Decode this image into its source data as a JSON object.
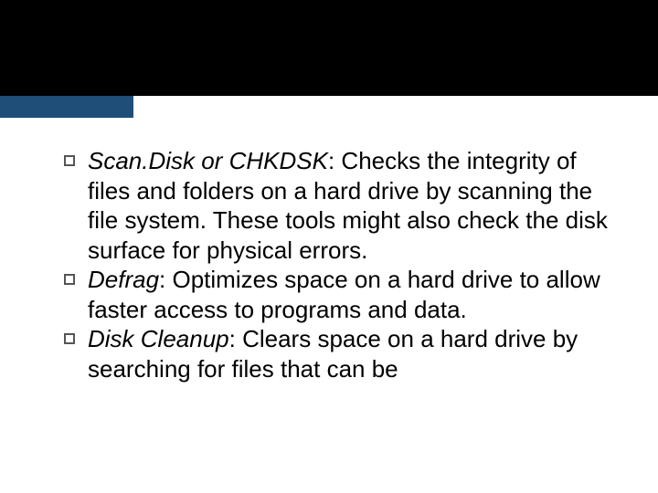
{
  "slide": {
    "items": [
      {
        "term": "Scan.Disk or CHKDSK",
        "desc": ": Checks the integrity of files and folders on a hard drive by scanning the file system. These tools might also check the disk  surface for physical errors."
      },
      {
        "term": "Defrag",
        "desc": ": Optimizes space on a hard drive to allow faster access to programs  and data."
      },
      {
        "term": "Disk Cleanup",
        "desc": ": Clears space on a hard drive by searching for files that can be"
      }
    ]
  }
}
